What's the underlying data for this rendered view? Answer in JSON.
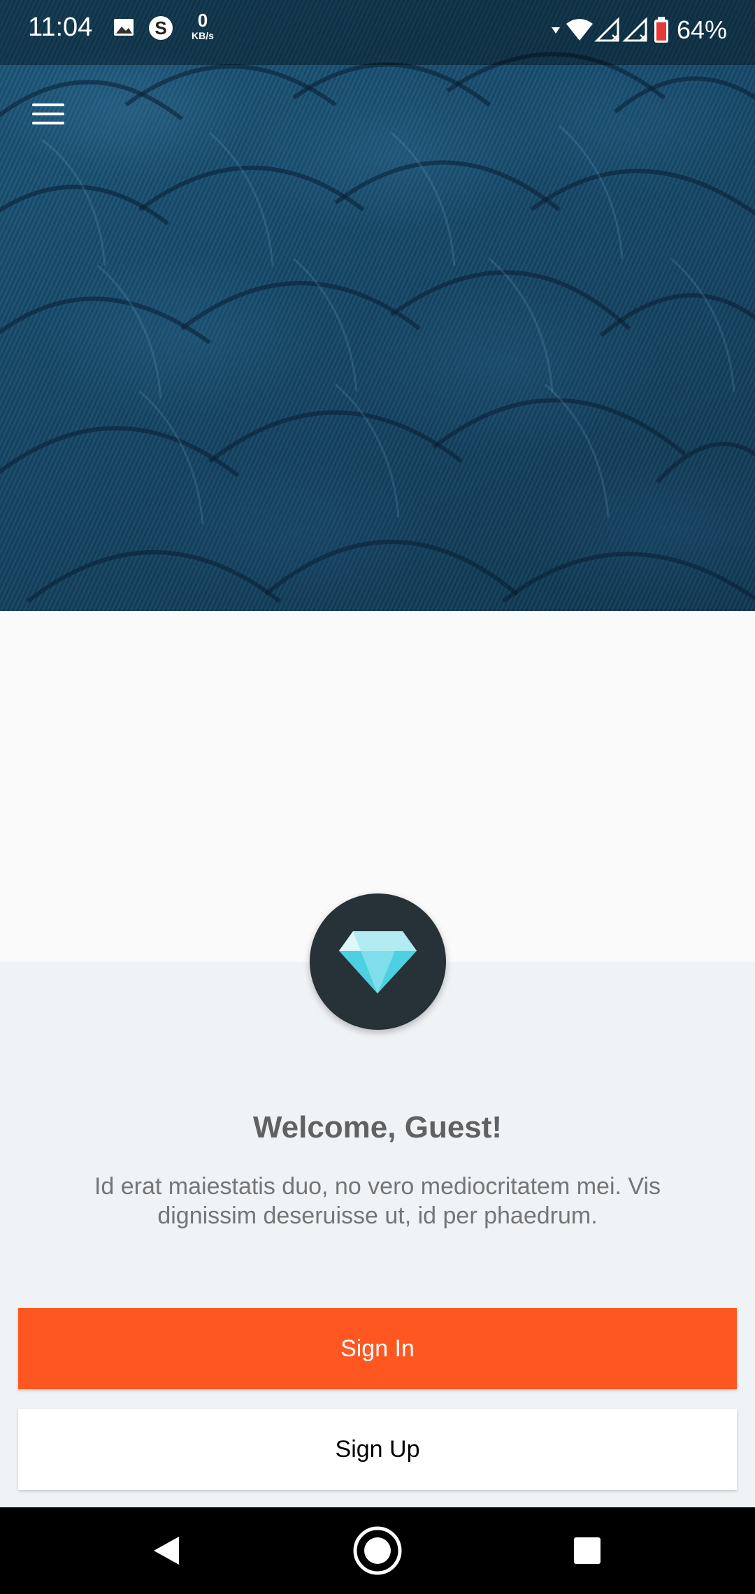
{
  "status_bar": {
    "time": "11:04",
    "network_speed_value": "0",
    "network_speed_unit": "KB/s",
    "battery_percent": "64%"
  },
  "welcome": {
    "title": "Welcome, Guest!",
    "description": "Id erat maiestatis duo, no vero mediocritatem mei. Vis dignissim deseruisse ut, id per phaedrum."
  },
  "buttons": {
    "sign_in": "Sign In",
    "sign_up": "Sign Up"
  },
  "icons": {
    "menu": "hamburger-menu-icon",
    "logo": "diamond-icon",
    "nav_back": "back-triangle-icon",
    "nav_home": "home-circle-icon",
    "nav_recents": "recents-square-icon"
  },
  "colors": {
    "primary": "#ff5722",
    "logo_circle": "#263238",
    "diamond": "#80deea"
  }
}
